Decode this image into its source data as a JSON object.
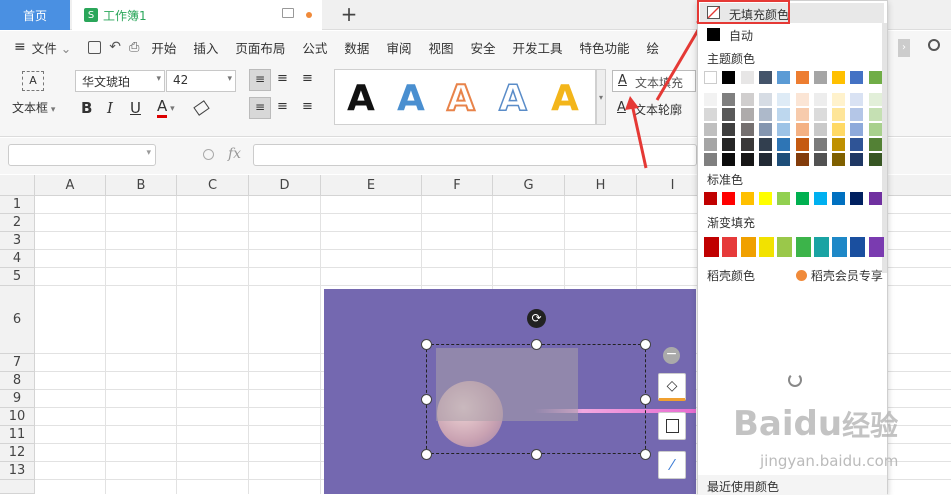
{
  "tabs": {
    "home": "首页",
    "doc": "工作簿1",
    "new": "+"
  },
  "menu": {
    "file": "文件",
    "items": [
      "开始",
      "插入",
      "页面布局",
      "公式",
      "数据",
      "审阅",
      "视图",
      "安全",
      "开发工具",
      "特色功能",
      "绘"
    ]
  },
  "ribbon": {
    "textbox_label": "文本框",
    "font_name": "华文琥珀",
    "font_size": "42",
    "bold": "B",
    "italic": "I",
    "underline": "U",
    "font_color_letter": "A",
    "art_letter": "A",
    "text_fill": "文本填充",
    "text_outline": "文本轮廓"
  },
  "formula": {
    "fx": "fx"
  },
  "columns": [
    "A",
    "B",
    "C",
    "D",
    "E",
    "F",
    "G",
    "H",
    "I"
  ],
  "rows": [
    "1",
    "2",
    "3",
    "4",
    "5",
    "6",
    "7",
    "8",
    "9",
    "10",
    "11",
    "12",
    "13"
  ],
  "dropdown": {
    "no_fill": "无填充颜色",
    "auto": "自动",
    "theme_colors": "主题颜色",
    "standard_colors": "标准色",
    "gradient_fill": "渐变填充",
    "docer_colors": "稻壳颜色",
    "docer_member": "稻壳会员专享",
    "recent_colors": "最近使用颜色"
  },
  "colors": {
    "theme_top": [
      "#ffffff",
      "#000000",
      "#e7e6e6",
      "#44546a",
      "#5b9bd5",
      "#ed7d31",
      "#a5a5a5",
      "#ffc000",
      "#4472c4",
      "#70ad47"
    ],
    "theme_shades": [
      [
        "#f2f2f2",
        "#7f7f7f",
        "#d0cece",
        "#d6dce4",
        "#deebf6",
        "#fbe5d5",
        "#ededed",
        "#fff2cc",
        "#d9e2f3",
        "#e2efd9"
      ],
      [
        "#d8d8d8",
        "#595959",
        "#aeabab",
        "#adb9ca",
        "#bdd7ee",
        "#f7cbac",
        "#dbdbdb",
        "#fee599",
        "#b4c6e7",
        "#c5e0b3"
      ],
      [
        "#bfbfbf",
        "#3f3f3f",
        "#757070",
        "#8496b0",
        "#9dc3e6",
        "#f4b183",
        "#c9c9c9",
        "#ffd965",
        "#8eaadb",
        "#a8d08d"
      ],
      [
        "#a5a5a5",
        "#262626",
        "#3a3838",
        "#323f4f",
        "#2e75b5",
        "#c55a11",
        "#7b7b7b",
        "#bf9000",
        "#2f5496",
        "#538135"
      ],
      [
        "#7f7f7f",
        "#0c0c0c",
        "#171616",
        "#222a35",
        "#1e4e79",
        "#833c0b",
        "#525252",
        "#7f6000",
        "#1f3864",
        "#375623"
      ]
    ],
    "standard": [
      "#c00000",
      "#ff0000",
      "#ffc000",
      "#ffff00",
      "#92d050",
      "#00b050",
      "#00b0f0",
      "#0070c0",
      "#002060",
      "#7030a0"
    ],
    "gradient": [
      "#c00000",
      "#e63a3a",
      "#f0a000",
      "#f2e200",
      "#9ac84a",
      "#3cb44a",
      "#1aa3a3",
      "#1e88c7",
      "#1a4f9f",
      "#7a3bb0"
    ]
  },
  "watermark": {
    "brand": "Baidu",
    "brand_cn": "经验",
    "url": "jingyan.baidu.com"
  }
}
